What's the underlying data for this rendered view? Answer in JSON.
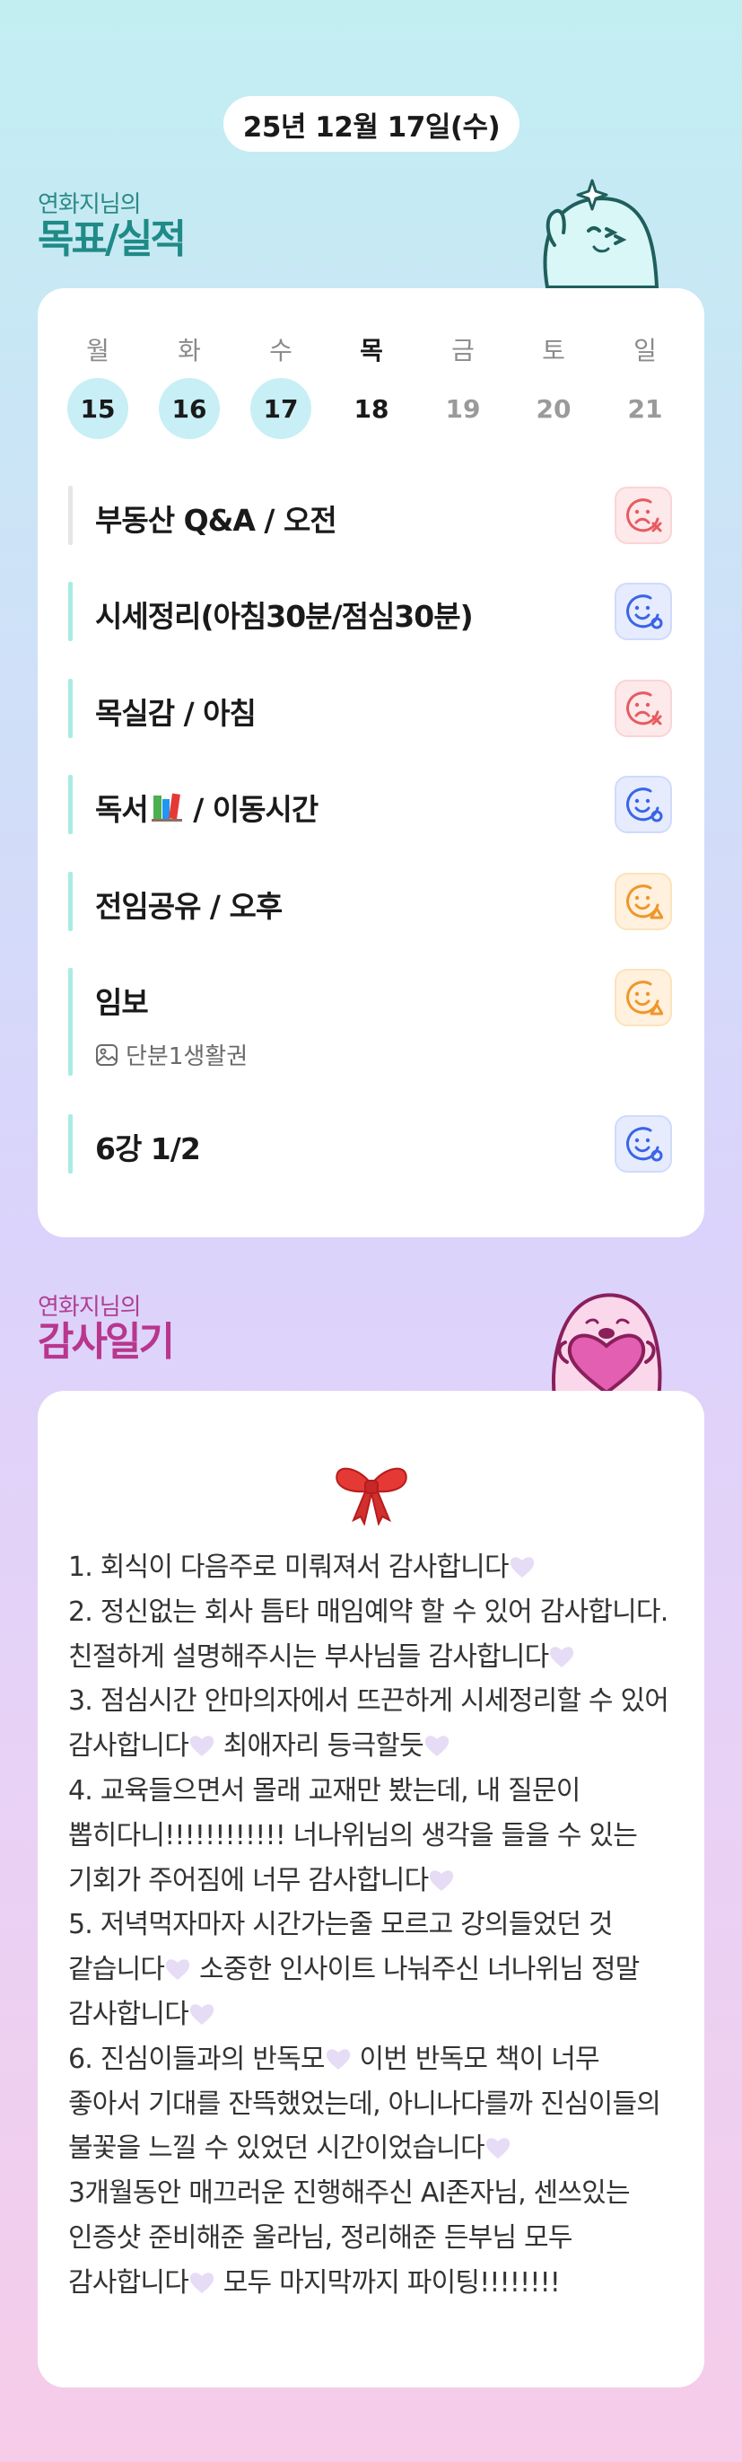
{
  "header": {
    "date": "25년 12월 17일(수)"
  },
  "goals_section": {
    "owner": "연화지님의",
    "title": "목표/실적"
  },
  "week": {
    "days": [
      {
        "name": "월",
        "date": "15",
        "state": "done"
      },
      {
        "name": "화",
        "date": "16",
        "state": "done"
      },
      {
        "name": "수",
        "date": "17",
        "state": "done"
      },
      {
        "name": "목",
        "date": "18",
        "state": "today"
      },
      {
        "name": "금",
        "date": "19",
        "state": "future"
      },
      {
        "name": "토",
        "date": "20",
        "state": "future"
      },
      {
        "name": "일",
        "date": "21",
        "state": "future"
      }
    ]
  },
  "goals": [
    {
      "text": "부동산 Q&A / 오전",
      "status": "fail",
      "status_icon": "sad-face-x-icon",
      "color": "#e85a5f"
    },
    {
      "text": "시세정리(아침30분/점심30분)",
      "status": "success",
      "status_icon": "smile-face-check-icon",
      "color": "#3a64e8"
    },
    {
      "text": "목실감 / 아침",
      "status": "fail",
      "status_icon": "sad-face-x-icon",
      "color": "#e85a5f"
    },
    {
      "text_before": "독서",
      "text_after": " / 이동시간",
      "emoji": "books-icon",
      "status": "success",
      "status_icon": "smile-face-check-icon",
      "color": "#3a64e8"
    },
    {
      "text": "전임공유 / 오후",
      "status": "partial",
      "status_icon": "neutral-face-triangle-icon",
      "color": "#f0962a"
    },
    {
      "text": "임보",
      "sub": "단분1생활권",
      "sub_icon": "image-icon",
      "status": "partial",
      "status_icon": "neutral-face-triangle-icon",
      "color": "#f0962a"
    },
    {
      "text": "6강 1/2",
      "status": "success",
      "status_icon": "smile-face-check-icon",
      "color": "#3a64e8"
    }
  ],
  "gratitude_section": {
    "owner": "연화지님의",
    "title": "감사일기"
  },
  "diary": {
    "lines": [
      "1. 회식이 다음주로 미뤄져서 감사합니다",
      "2. 정신없는 회사 틈타 매임예약 할 수 있어 감사합니다. 친절하게 설명해주시는 부사님들 감사합니다",
      "3. 점심시간 안마의자에서 뜨끈하게 시세정리할 수 있어 감사합니다",
      " 최애자리 등극할듯",
      "4. 교육들으면서 몰래 교재만 봤는데, 내 질문이 뽑히다니!!!!!!!!!!!! 너나위님의 생각을 들을 수 있는 기회가 주어짐에 너무 감사합니다",
      "5. 저녁먹자마자 시간가는줄 모르고 강의들었던 것 같습니다",
      " 소중한 인사이트 나눠주신 너나위님 정말 감사합니다",
      "6. 진심이들과의 반독모",
      " 이번 반독모 책이 너무 좋아서 기대를 잔뜩했었는데, 아니나다를까 진심이들의 불꽃을 느낄 수 있었던 시간이었습니다",
      "3개월동안 매끄러운 진행해주신 AI존자님, 센쓰있는 인증샷 준비해준 울라님, 정리해준 든부님 모두 감사합니다",
      " 모두 마지막까지 파이팅!!!!!!!!"
    ]
  },
  "colors": {
    "accent_teal": "#1f8a86",
    "accent_pink": "#b8368e",
    "done_circle": "#c7eff5",
    "bar": "#a8ece4"
  }
}
